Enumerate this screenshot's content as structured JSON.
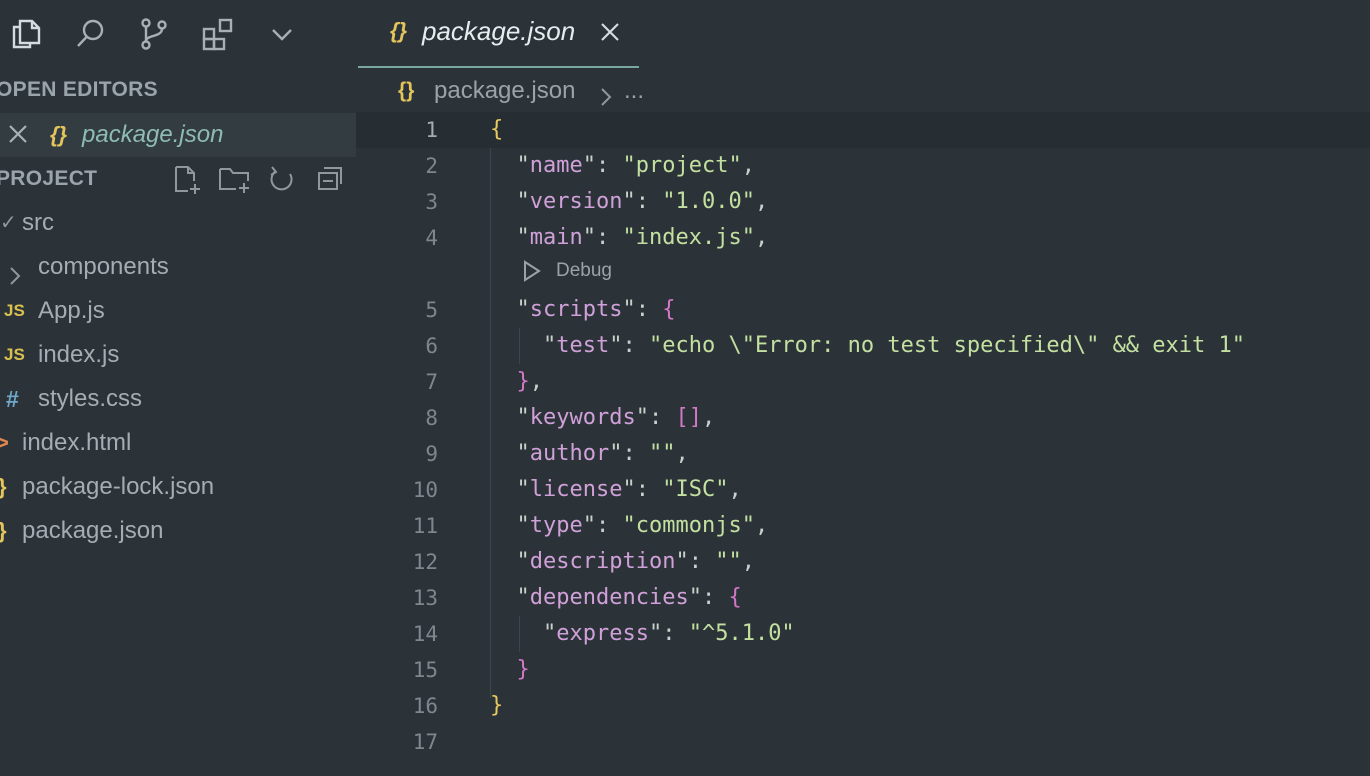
{
  "sidebar": {
    "open_editors_title": "OPEN EDITORS",
    "open_editor_file": "package.json",
    "project_title": "PROJECT",
    "tree": [
      {
        "label": "src",
        "icon": "chevron-down-icon",
        "glyph": "✓"
      },
      {
        "label": "components",
        "icon": "chevron-right-icon",
        "glyph": ""
      },
      {
        "label": "App.js",
        "icon": "js-file-icon",
        "glyph": "JS"
      },
      {
        "label": "index.js",
        "icon": "js-file-icon",
        "glyph": "JS"
      },
      {
        "label": "styles.css",
        "icon": "css-file-icon",
        "glyph": "#"
      },
      {
        "label": "index.html",
        "icon": "html-file-icon",
        "glyph": ">"
      },
      {
        "label": "package-lock.json",
        "icon": "json-file-icon",
        "glyph": "}"
      },
      {
        "label": "package.json",
        "icon": "json-file-icon",
        "glyph": "}"
      }
    ]
  },
  "editor": {
    "tab_label": "package.json",
    "json_glyph": "{}",
    "breadcrumb_file": "package.json",
    "breadcrumb_more": "...",
    "codelens": "Debug",
    "line_numbers": [
      "1",
      "2",
      "3",
      "4",
      "5",
      "6",
      "7",
      "8",
      "9",
      "10",
      "11",
      "12",
      "13",
      "14",
      "15",
      "16",
      "17"
    ],
    "lines": [
      "{",
      "  \"name\": \"project\",",
      "  \"version\": \"1.0.0\",",
      "  \"main\": \"index.js\",",
      "  \"scripts\": {",
      "    \"test\": \"echo \\\"Error: no test specified\\\" && exit 1\"",
      "  },",
      "  \"keywords\": [],",
      "  \"author\": \"\",",
      "  \"license\": \"ISC\",",
      "  \"type\": \"commonjs\",",
      "  \"description\": \"\",",
      "  \"dependencies\": {",
      "    \"express\": \"^5.1.0\"",
      "  }",
      "}",
      ""
    ]
  },
  "colors": {
    "background": "#2b3339",
    "key": "#d0a0d8",
    "string": "#c3e0a0",
    "brace": "#e8c95e",
    "accent": "#78a7a0"
  }
}
